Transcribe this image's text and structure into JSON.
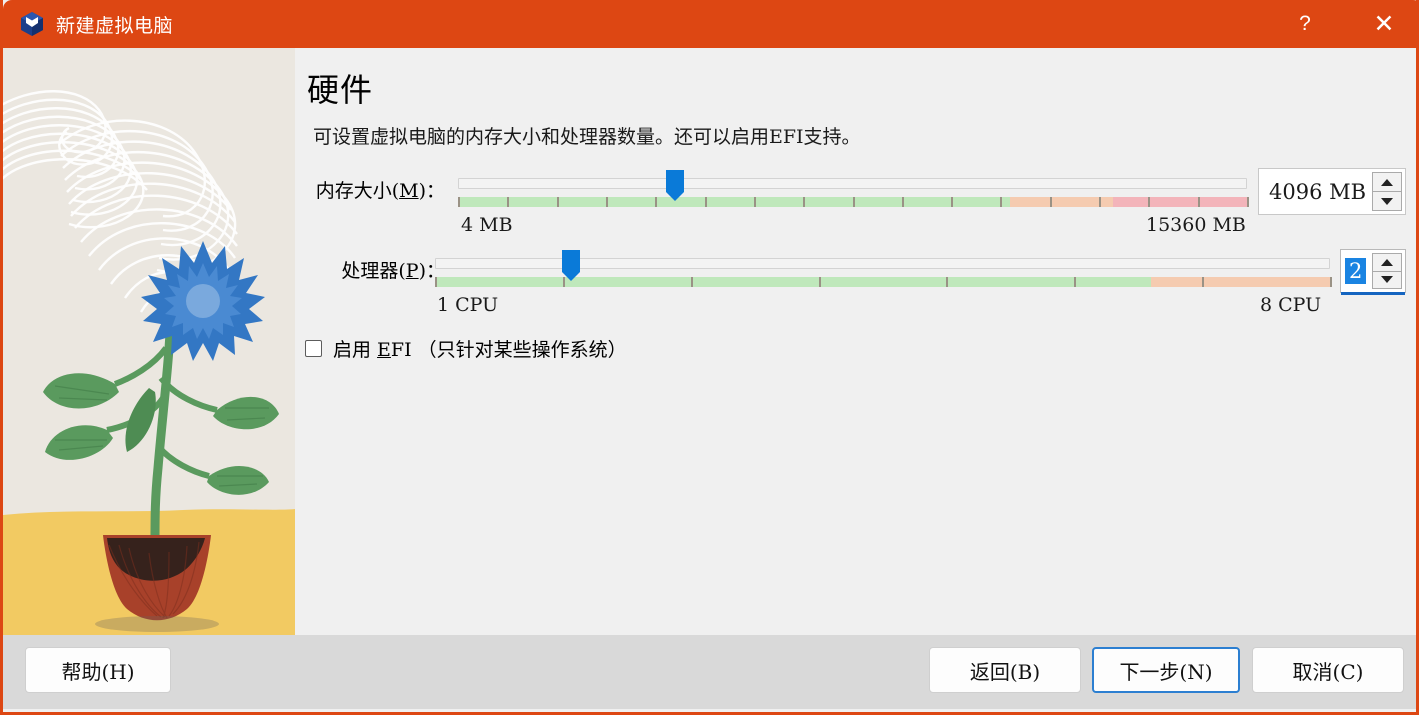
{
  "window": {
    "title": "新建虚拟电脑",
    "app_icon": "virtualbox-cube-icon",
    "help_button": "?",
    "close_button": "✕",
    "accent_color": "#dd4713"
  },
  "page": {
    "title": "硬件",
    "description": "可设置虚拟电脑的内存大小和处理器数量。还可以启用EFI支持。"
  },
  "memory": {
    "label_prefix": "内存大小(",
    "label_mnemonic": "M",
    "label_suffix": ")：",
    "min_label": "4 MB",
    "max_label": "15360 MB",
    "value": "4096 MB",
    "slider_percent": 27.5,
    "segments": [
      {
        "color": "#bfe8bb",
        "width_percent": 70
      },
      {
        "color": "#f5cbb0",
        "width_percent": 13
      },
      {
        "color": "#f3b4ba",
        "width_percent": 17
      }
    ],
    "spin_up": "▲",
    "spin_down": "▼"
  },
  "processors": {
    "label_prefix": "处理器(",
    "label_mnemonic": "P",
    "label_suffix": ")：",
    "min_label": "1 CPU",
    "max_label": "8 CPU",
    "value": "2",
    "slider_percent": 15.2,
    "segments": [
      {
        "color": "#bfe8bb",
        "width_percent": 80
      },
      {
        "color": "#f5cbb0",
        "width_percent": 20
      }
    ],
    "spin_up": "▲",
    "spin_down": "▼"
  },
  "efi": {
    "checked": false,
    "label_prefix": "启用 ",
    "label_mnemonic": "E",
    "label_suffix": "FI （只针对某些操作系统）"
  },
  "footer": {
    "help": "帮助(H)",
    "help_mnemonic": "H",
    "back": "返回(B)",
    "back_mnemonic": "B",
    "next": "下一步(N)",
    "next_mnemonic": "N",
    "cancel": "取消(C)",
    "cancel_mnemonic": "C"
  },
  "illustration": {
    "name": "potted-flower-illustration",
    "background_color": "#ebe7e0",
    "ground_color": "#f2ca62",
    "flower_color": "#3377c4",
    "leaf_color": "#5a9a5e",
    "pot_color": "#a8412a"
  }
}
